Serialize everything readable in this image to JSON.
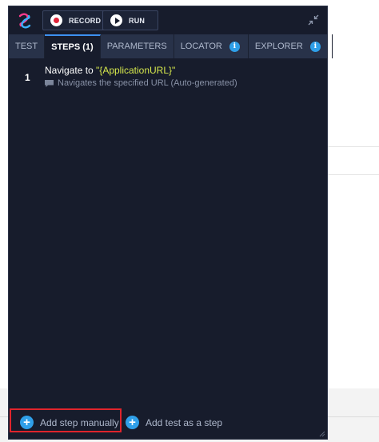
{
  "colors": {
    "panel_bg": "#171c2c",
    "tab_bar_bg": "#283249",
    "accent_blue": "#2f9fe8",
    "record_red": "#e0243a",
    "param_yellow": "#d6e84c",
    "highlight_red": "#e0242c"
  },
  "toolbar": {
    "record_label": "RECORD",
    "run_label": "RUN",
    "icons": [
      "app-logo-icon",
      "record-icon",
      "play-icon",
      "collapse-icon"
    ]
  },
  "tabs": [
    {
      "label": "TEST",
      "active": false
    },
    {
      "label": "STEPS (1)",
      "active": true
    },
    {
      "label": "PARAMETERS",
      "active": false
    },
    {
      "label": "LOCATOR",
      "active": false,
      "info": "i"
    },
    {
      "label": "EXPLORER",
      "active": false,
      "info": "i"
    }
  ],
  "steps": [
    {
      "number": "1",
      "title_prefix": "Navigate to",
      "title_param": "\"{ApplicationURL}\"",
      "description": "Navigates the specified URL (Auto-generated)"
    }
  ],
  "footer": {
    "add_step_label": "Add step manually",
    "add_test_label": "Add test as a step",
    "plus_glyph": "+"
  }
}
